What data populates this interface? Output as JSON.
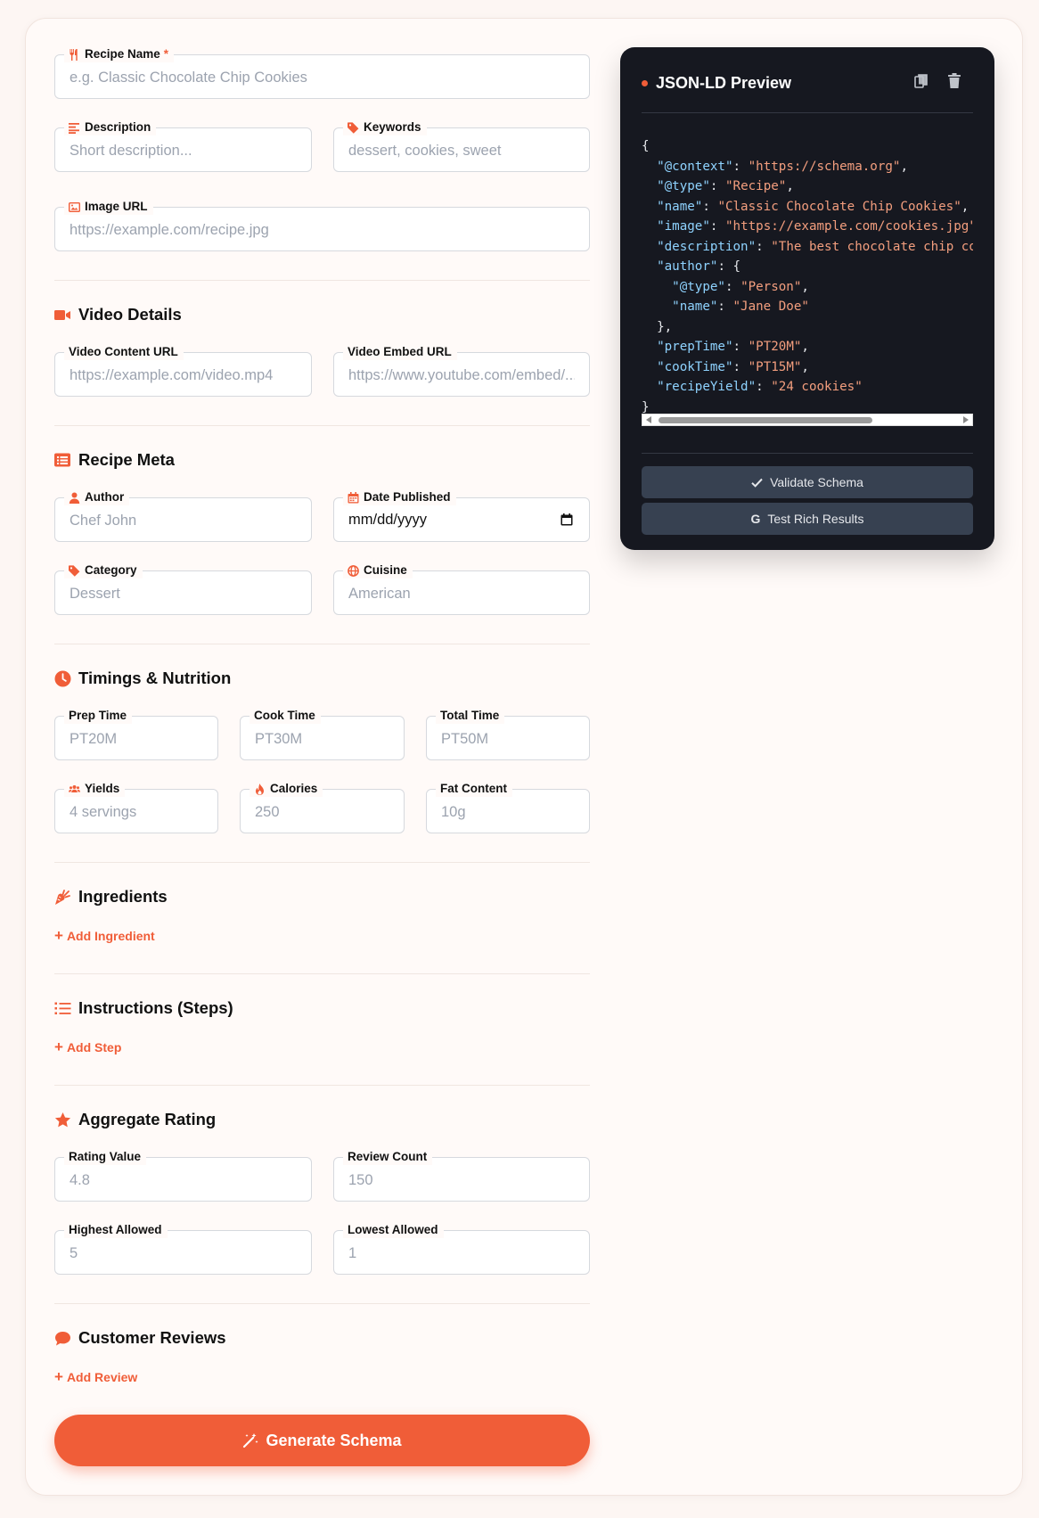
{
  "form": {
    "recipe_name": {
      "label": "Recipe Name",
      "required_mark": "*",
      "placeholder": "e.g. Classic Chocolate Chip Cookies"
    },
    "description": {
      "label": "Description",
      "placeholder": "Short description..."
    },
    "keywords": {
      "label": "Keywords",
      "placeholder": "dessert, cookies, sweet"
    },
    "image_url": {
      "label": "Image URL",
      "placeholder": "https://example.com/recipe.jpg"
    }
  },
  "video": {
    "title": "Video Details",
    "content_url": {
      "label": "Video Content URL",
      "placeholder": "https://example.com/video.mp4"
    },
    "embed_url": {
      "label": "Video Embed URL",
      "placeholder": "https://www.youtube.com/embed/..."
    }
  },
  "meta": {
    "title": "Recipe Meta",
    "author": {
      "label": "Author",
      "placeholder": "Chef John"
    },
    "date_published": {
      "label": "Date Published",
      "value": "mm/dd/yyyy"
    },
    "category": {
      "label": "Category",
      "placeholder": "Dessert"
    },
    "cuisine": {
      "label": "Cuisine",
      "placeholder": "American"
    }
  },
  "timings": {
    "title": "Timings & Nutrition",
    "prep_time": {
      "label": "Prep Time",
      "placeholder": "PT20M"
    },
    "cook_time": {
      "label": "Cook Time",
      "placeholder": "PT30M"
    },
    "total_time": {
      "label": "Total Time",
      "placeholder": "PT50M"
    },
    "yields": {
      "label": "Yields",
      "placeholder": "4 servings"
    },
    "calories": {
      "label": "Calories",
      "placeholder": "250"
    },
    "fat_content": {
      "label": "Fat Content",
      "placeholder": "10g"
    }
  },
  "ingredients": {
    "title": "Ingredients",
    "add_label": "Add Ingredient"
  },
  "instructions": {
    "title": "Instructions (Steps)",
    "add_label": "Add Step"
  },
  "rating": {
    "title": "Aggregate Rating",
    "rating_value": {
      "label": "Rating Value",
      "placeholder": "4.8"
    },
    "review_count": {
      "label": "Review Count",
      "placeholder": "150"
    },
    "highest_allowed": {
      "label": "Highest Allowed",
      "placeholder": "5"
    },
    "lowest_allowed": {
      "label": "Lowest Allowed",
      "placeholder": "1"
    }
  },
  "reviews": {
    "title": "Customer Reviews",
    "add_label": "Add Review"
  },
  "generate_label": "Generate Schema",
  "preview": {
    "title": "JSON-LD Preview",
    "code_lines": [
      [
        [
          "",
          "{"
        ]
      ],
      [
        [
          "",
          "  "
        ],
        [
          "k",
          "\"@context\""
        ],
        [
          "",
          ": "
        ],
        [
          "s",
          "\"https://schema.org\""
        ],
        [
          "",
          ","
        ]
      ],
      [
        [
          "",
          "  "
        ],
        [
          "k",
          "\"@type\""
        ],
        [
          "",
          ": "
        ],
        [
          "s",
          "\"Recipe\""
        ],
        [
          "",
          ","
        ]
      ],
      [
        [
          "",
          "  "
        ],
        [
          "k",
          "\"name\""
        ],
        [
          "",
          ": "
        ],
        [
          "s",
          "\"Classic Chocolate Chip Cookies\""
        ],
        [
          "",
          ","
        ]
      ],
      [
        [
          "",
          "  "
        ],
        [
          "k",
          "\"image\""
        ],
        [
          "",
          ": "
        ],
        [
          "s",
          "\"https://example.com/cookies.jpg\""
        ],
        [
          "",
          ","
        ]
      ],
      [
        [
          "",
          "  "
        ],
        [
          "k",
          "\"description\""
        ],
        [
          "",
          ": "
        ],
        [
          "s",
          "\"The best chocolate chip cookies\""
        ],
        [
          "",
          ","
        ]
      ],
      [
        [
          "",
          "  "
        ],
        [
          "k",
          "\"author\""
        ],
        [
          "",
          ": {"
        ]
      ],
      [
        [
          "",
          "    "
        ],
        [
          "k",
          "\"@type\""
        ],
        [
          "",
          ": "
        ],
        [
          "s",
          "\"Person\""
        ],
        [
          "",
          ","
        ]
      ],
      [
        [
          "",
          "    "
        ],
        [
          "k",
          "\"name\""
        ],
        [
          "",
          ": "
        ],
        [
          "s",
          "\"Jane Doe\""
        ]
      ],
      [
        [
          "",
          "  },"
        ]
      ],
      [
        [
          "",
          "  "
        ],
        [
          "k",
          "\"prepTime\""
        ],
        [
          "",
          ": "
        ],
        [
          "s",
          "\"PT20M\""
        ],
        [
          "",
          ","
        ]
      ],
      [
        [
          "",
          "  "
        ],
        [
          "k",
          "\"cookTime\""
        ],
        [
          "",
          ": "
        ],
        [
          "s",
          "\"PT15M\""
        ],
        [
          "",
          ","
        ]
      ],
      [
        [
          "",
          "  "
        ],
        [
          "k",
          "\"recipeYield\""
        ],
        [
          "",
          ": "
        ],
        [
          "s",
          "\"24 cookies\""
        ]
      ],
      [
        [
          "",
          "}"
        ]
      ]
    ],
    "validate_label": "Validate Schema",
    "test_label": "Test Rich Results"
  },
  "colors": {
    "accent": "#f05d38",
    "panel": "#161820",
    "key": "#8fd3ff",
    "string": "#f39e7e"
  }
}
